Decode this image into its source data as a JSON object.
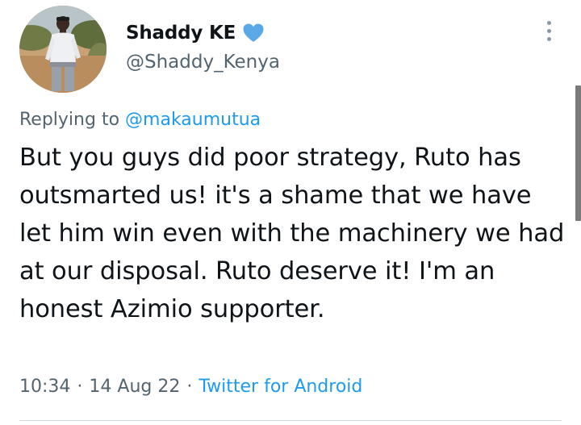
{
  "author": {
    "display_name": "Shaddy KE",
    "handle": "@Shaddy_Kenya",
    "verified_icon": "verified-heart-icon",
    "verified_color": "#5aa9e6"
  },
  "reply": {
    "prefix": "Replying to",
    "mention": "@makaumutua"
  },
  "tweet": {
    "text": "But you guys did poor strategy, Ruto has outsmarted us! it's a shame that we have let him win even with the machinery we had at our disposal. Ruto deserve it! I'm an honest Azimio supporter."
  },
  "meta": {
    "time": "10:34",
    "separator": "·",
    "date": "14 Aug 22",
    "source": "Twitter for Android"
  },
  "colors": {
    "text": "#0f1419",
    "secondary": "#536471",
    "link": "#1d9bf0"
  }
}
